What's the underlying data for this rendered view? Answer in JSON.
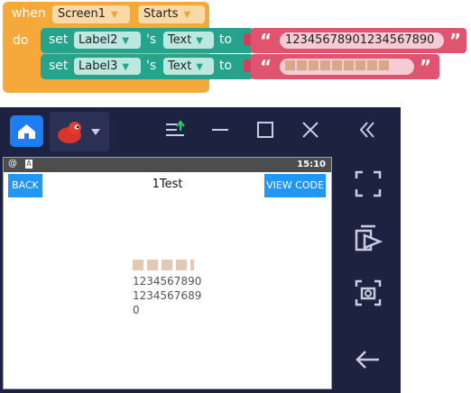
{
  "blocks": {
    "when_label": "when",
    "component": "Screen1",
    "event": "Starts",
    "do_label": "do",
    "rows": [
      {
        "set_label": "set",
        "target": "Label2",
        "possessive": "'s",
        "property": "Text",
        "to_label": "to",
        "value": "12345678901234567890"
      },
      {
        "set_label": "set",
        "target": "Label3",
        "possessive": "'s",
        "property": "Text",
        "to_label": "to",
        "value": ""
      }
    ],
    "colors": {
      "event": "#f4a93a",
      "setter": "#25a38c",
      "text": "#e0546f"
    }
  },
  "emulator": {
    "icons": [
      "home-icon",
      "app-mascot-icon",
      "install-apk-icon",
      "minimize-icon",
      "maximize-icon",
      "close-icon",
      "collapse-icon"
    ],
    "statusbar": {
      "time": "15:10",
      "left_icons": [
        "@",
        "A"
      ]
    },
    "appbar": {
      "back_label": "BACK",
      "title": "1Test",
      "view_code_label": "VIEW CODE"
    },
    "content": {
      "label2_line1": "1234567890",
      "label2_line2": "1234567689",
      "label2_line3": "0"
    },
    "sidebar_icons": [
      "fullscreen-icon",
      "install-icon",
      "screenshot-icon",
      "back-arrow-icon"
    ]
  }
}
